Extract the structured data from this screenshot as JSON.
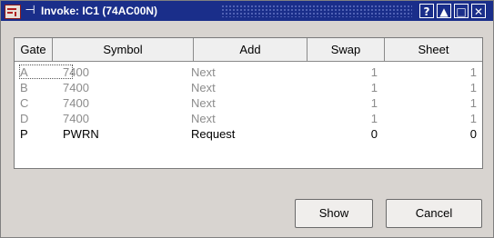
{
  "window": {
    "title": "Invoke: IC1  (74AC00N)",
    "title_buttons": [
      "?",
      "▲",
      "□",
      "✕"
    ]
  },
  "table": {
    "columns": [
      "Gate",
      "Symbol",
      "Add",
      "Swap",
      "Sheet"
    ],
    "rows": [
      {
        "gate": "A",
        "symbol": "7400",
        "add": "Next",
        "swap": "1",
        "sheet": "1",
        "active": false
      },
      {
        "gate": "B",
        "symbol": "7400",
        "add": "Next",
        "swap": "1",
        "sheet": "1",
        "active": false
      },
      {
        "gate": "C",
        "symbol": "7400",
        "add": "Next",
        "swap": "1",
        "sheet": "1",
        "active": false
      },
      {
        "gate": "D",
        "symbol": "7400",
        "add": "Next",
        "swap": "1",
        "sheet": "1",
        "active": false
      },
      {
        "gate": "P",
        "symbol": "PWRN",
        "add": "Request",
        "swap": "0",
        "sheet": "0",
        "active": true
      }
    ]
  },
  "buttons": {
    "show": "Show",
    "cancel": "Cancel"
  },
  "colors": {
    "titlebar": "#1a2e8a",
    "inactive_text": "#8c8c8c",
    "active_text": "#000000"
  }
}
